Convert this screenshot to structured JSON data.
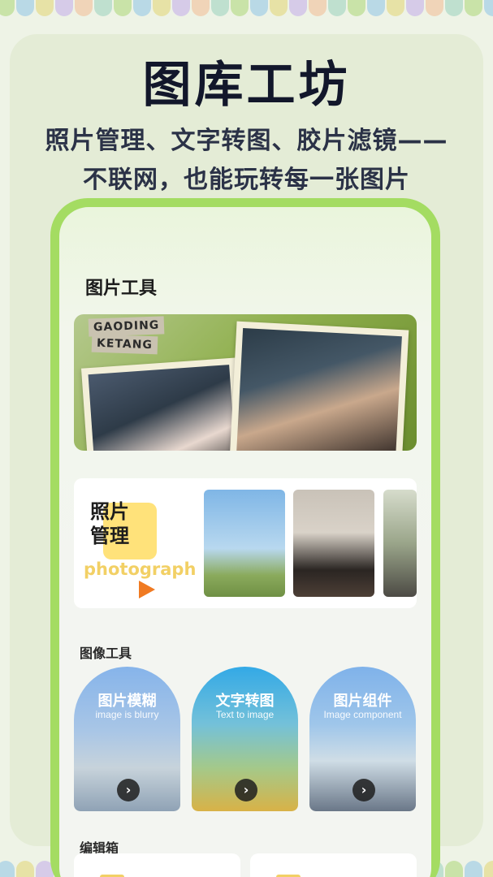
{
  "colors": {
    "accent_green": "#a4dc62",
    "title": "#12172b",
    "highlight_yellow": "#ffe27a",
    "play_orange": "#f07a22"
  },
  "hero": {
    "title": "图库工坊",
    "subtitle_line1": "照片管理、文字转图、胶片滤镜——",
    "subtitle_line2": "不联网，也能玩转每一张图片"
  },
  "app": {
    "section_picture_tools": "图片工具",
    "banner": {
      "tape_line1": "GAODING",
      "tape_line2": "KETANG"
    },
    "photo_management": {
      "title_line1": "照片",
      "title_line2": "管理",
      "english": "photograph",
      "play_icon": "play-icon"
    },
    "section_image_tools": "图像工具",
    "image_tools": [
      {
        "label": "图片模糊",
        "sub": "image is blurry",
        "icon": "arrow-right-icon"
      },
      {
        "label": "文字转图",
        "sub": "Text to image",
        "icon": "arrow-right-icon"
      },
      {
        "label": "图片组件",
        "sub": "Image component",
        "icon": "arrow-right-icon"
      }
    ],
    "section_edit_box": "编辑箱"
  }
}
